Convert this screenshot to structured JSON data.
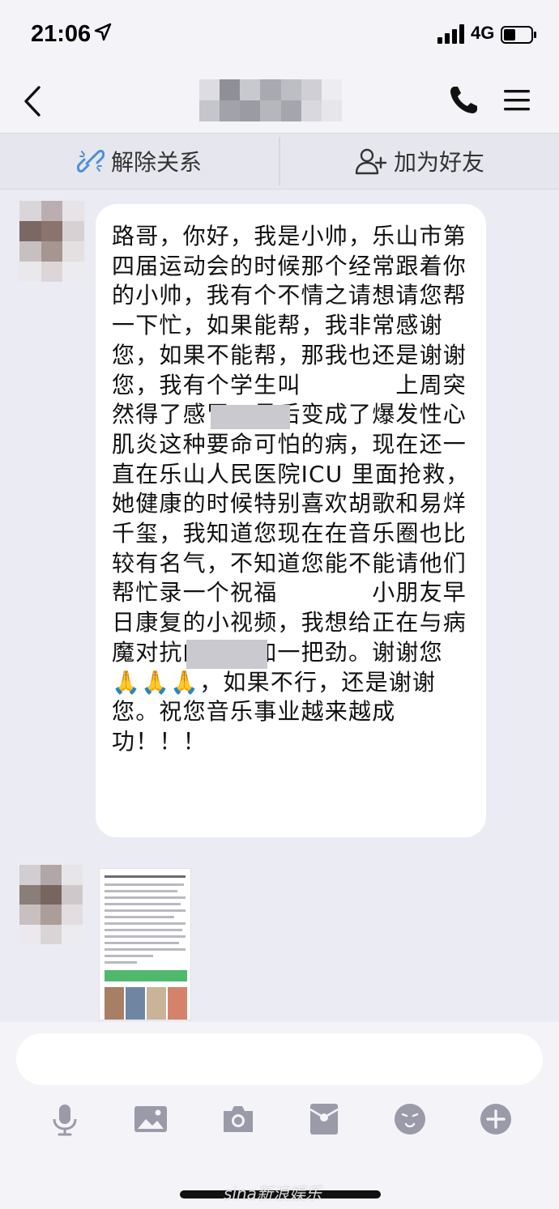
{
  "status_bar": {
    "time": "21:06",
    "network": "4G"
  },
  "nav": {
    "back_icon": "chevron-left-icon",
    "call_icon": "phone-icon",
    "menu_icon": "hamburger-menu-icon"
  },
  "actions": {
    "unlink_label": "解除关系",
    "add_friend_label": "加为好友"
  },
  "messages": [
    {
      "text": "路哥，你好，我是小帅，乐山市第四届运动会的时候那个经常跟着你的小帅，我有个不情之请想请您帮一下忙，如果能帮，我非常感谢您，如果不能帮，那我也还是谢谢您，我有个学生叫　　　　上周突然得了感冒，最后变成了爆发性心肌炎这种要命可怕的病，现在还一直在乐山人民医院ICU 里面抢救，她健康的时候特别喜欢胡歌和易烊千玺，我知道您现在在音乐圈也比较有名气，不知道您能不能请他们帮忙录一个祝福　　　　小朋友早日康复的小视频，我想给正在与病魔对抗的她再加一把劲。谢谢您🙏🙏🙏，如果不行，还是谢谢您。祝您音乐事业越来越成功！！！"
    }
  ],
  "colors": {
    "background": "#ebebf3",
    "bubble": "#ffffff",
    "accent_blue": "#4a90d9",
    "icon_gray": "#9a9aa8"
  },
  "toolbar_icons": [
    "microphone-icon",
    "image-icon",
    "camera-icon",
    "red-packet-icon",
    "emoji-icon",
    "plus-icon"
  ],
  "watermark": "sina新浪娱乐"
}
